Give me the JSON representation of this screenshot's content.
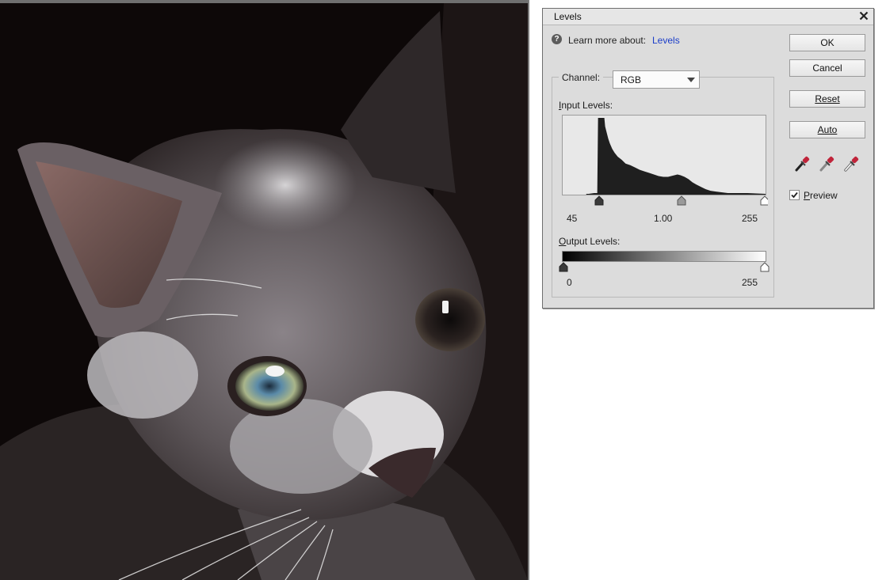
{
  "dialog": {
    "title": "Levels",
    "learn_more_text": "Learn more about:",
    "learn_more_link": "Levels",
    "buttons": {
      "ok": "OK",
      "cancel": "Cancel",
      "reset": "Reset",
      "auto": "Auto"
    },
    "channel": {
      "label": "Channel:",
      "value": "RGB"
    },
    "input_levels": {
      "label": "Input Levels:",
      "black": "45",
      "gamma": "1.00",
      "white": "255"
    },
    "output_levels": {
      "label": "Output Levels:",
      "black": "0",
      "white": "255"
    },
    "preview": {
      "label": "Preview",
      "checked": true
    },
    "icons": {
      "help": "question-icon",
      "close": "close-icon",
      "droppers": [
        "black-point-eyedropper-icon",
        "gray-point-eyedropper-icon",
        "white-point-eyedropper-icon"
      ]
    }
  },
  "colors": {
    "link": "#1a3cc9",
    "dialog_bg": "#dcdcdc",
    "histogram_fill": "#1f1f1f"
  }
}
